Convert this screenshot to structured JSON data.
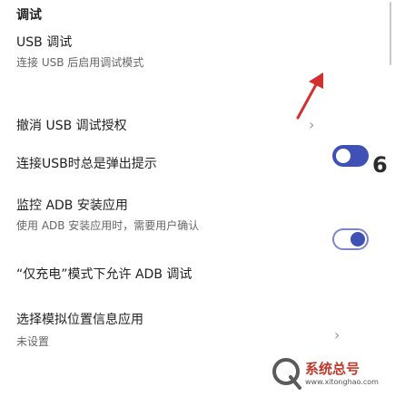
{
  "header": {
    "title": "调试"
  },
  "items": [
    {
      "title": "USB 调试",
      "subtitle": "连接 USB 后启用调试模式"
    },
    {
      "title": "撤消 USB 调试授权"
    },
    {
      "title": "连接USB时总是弹出提示"
    },
    {
      "title": "监控 ADB 安装应用",
      "subtitle": "使用 ADB 安装应用时，需要用户确认"
    },
    {
      "title": "“仅充电”模式下允许 ADB 调试"
    },
    {
      "title": "选择模拟位置信息应用",
      "subtitle": "未设置"
    }
  ],
  "overlay": {
    "number": "6"
  },
  "watermark": {
    "name": "系统总号",
    "url": "www.xitonghao.com"
  },
  "colors": {
    "accent": "#3f51b5",
    "annotation": "#d32f2f"
  }
}
